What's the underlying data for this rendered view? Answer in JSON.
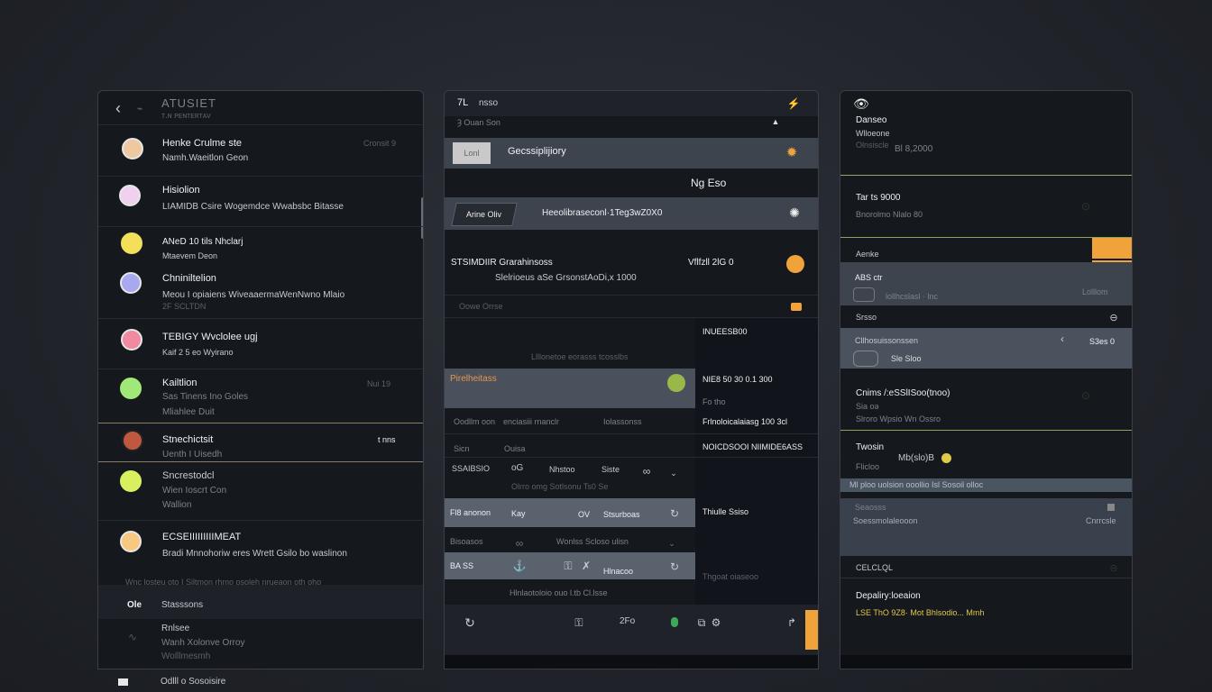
{
  "left_panel": {
    "title": "ATUSIET",
    "subtitle": "ᴛ.ɴ ᴘᴇɴᴛᴇʀᴛᴀᴠ",
    "items": [
      {
        "name": "Henke Crulme  ste",
        "meta": "Namh.Waeitlon Geon",
        "time": "Cronsit 9",
        "color": "#f0c8a0"
      },
      {
        "name": "Hisiolion",
        "meta": "LIAMIDB Csire Wogemdce Wwabsbc Bitasse",
        "time": "",
        "color": "#f0d0f0"
      },
      {
        "name": "ANeD 10  tils  Nhclarj",
        "meta": "Mtaevem Deon",
        "time": "",
        "color": "#f2e05a"
      },
      {
        "name": "Chniniltelion",
        "meta": "Meou I opiaiens WiveaaermaWenNwno Mlaio",
        "meta2": "2F SCLTDN",
        "time": "",
        "color": "#a8a8f0"
      },
      {
        "name": "TEBIGY   Wvclolee ugj",
        "meta": "Kaif 2 5 eo Wyirano",
        "time": "",
        "color": "#f08aa0"
      },
      {
        "name": "Kailtlion",
        "meta": "Sas Tinens Ino Goles",
        "meta2": "Mliahlee Duit",
        "time": "Nui 19",
        "color": "#a0e878"
      },
      {
        "name": "Stnechictsit",
        "meta": "Uenth I Uisedh",
        "time": "t  nns",
        "color": "#c05840"
      },
      {
        "name": "Sncrestodcl",
        "meta": "Wien Ioscrt Con",
        "meta2": "Wallion",
        "time": "",
        "color": "#d8f060"
      },
      {
        "name": "ECSEIIIIIIIIIMEAT",
        "meta": "Bradi  Mnnohoriw eres Wrett  Gsilo bo waslinon",
        "time": "",
        "color": "#f8c880"
      }
    ],
    "footer_caption": "Wnc losteu oto I Siltmon rhmo osoleh nrueaon oth oho",
    "footer_item1": "Stasssons",
    "footer_item1_icon": "Ole",
    "footer_item2_title": "Rnlsee",
    "footer_item2_meta": "Wanh Xolonve Orroy",
    "footer_item2_meta2": "Wolllmesmh",
    "bottom_label": "Odlll o Sosoisire"
  },
  "middle_panel": {
    "header_title": "nsso",
    "header_back": "7L",
    "sub_label": "Ȝ Ouan Son",
    "bar1_badge": "Lonl",
    "bar1_title": "Gecssiplijiory",
    "amount": "Ng  Eso",
    "pill_label": "Arine Oliv",
    "pill_text": "Heeolibraseconl·1Teg3wZ0X0",
    "stat_left": "STSIMDIIR  Grarahinsoss",
    "stat_left2": "Slelrioeus aSe GrsonstAoDi,x 1000",
    "stat_right": "Vflfzll 2lG 0",
    "section_head_left": "Oowe   Orrse",
    "section_head_right": "INUEESB00",
    "row_a": "Llllonetoe eorasss tcosslbs",
    "row_highlight_label": "Pirelheitass",
    "row_highlight_right": "NIE8 50 30   0.1 300",
    "row_highlight_right2": "Fo tho",
    "row_c_cells": [
      "Oodllm oon",
      "enciasiii rnanclr",
      "Iolassonss"
    ],
    "row_c_right": "Frlnoloicalaiasg 100 3cl",
    "row_d_cells": [
      "Sicn",
      "Ouisa"
    ],
    "row_d_right": "NOICDSOOI NIIMIDE6ASS",
    "row_e_cells": [
      "SSAIBSIO",
      "ᴏG",
      "Nhstoo",
      "Siste"
    ],
    "row_e2": "Olrro omg Sotlsonu Ts0 Se",
    "row_f_cells": [
      "Fl8 anonon",
      "Kay",
      "OV",
      "Stsurboas"
    ],
    "row_f_right": "Thiulle Ssiso",
    "row_g_cells": [
      "Bisoasos",
      "Wonlss Scloso ulisn"
    ],
    "row_h_cells": [
      "BA  SS",
      "Hlnacoo"
    ],
    "row_h_right": "Thgoat oiaseoo",
    "row_i": "Hlnlaotoloio  ouo l.tb Cl.lsse",
    "zoom": "2Fo"
  },
  "right_panel": {
    "header_icon": "eye-icon",
    "title": "Danseo",
    "meta": "Wlloeone",
    "meta2": "Olnsiscle",
    "amount": "Bl 8,2000",
    "row2_title": "Tar ts 9000",
    "row2_meta": "Bnorolmo Nlalo 80",
    "section": "Aenke",
    "bar1_title": "ABS ctr",
    "bar1_meta": "lollhcslasl · lnc",
    "bar1_right": "Lolllom",
    "row3_title": "Srsso",
    "bar2_title": "Cllhosuissonssen",
    "bar2_meta": "Sle Sloo",
    "bar2_right": "S3es 0",
    "row4_title": "Cnims   /:eSSlISoo(tnoo)",
    "row4_meta": "Sia ᴏǝ",
    "row4_meta2": "Slroro Wpsio Wn Ossro",
    "row5_title": "Twosin",
    "row5_amount": "Mb(slo)B",
    "row5_meta": "Flicloo",
    "band_text": "Ml ploo uolsion ooollio Isl Sosoil olloc",
    "row6_title": "Seaosss",
    "row6_meta": "Soessmolaleooon",
    "row6_right": "Cnrrcsle",
    "row7_title": "CELCLQL",
    "row8_title": "Depaliry:loeaion",
    "row8_meta": "LSE ThO 9Z8·  Mot  Bhlsodio... Mmh"
  },
  "colors": {
    "accent": "#f0a33a",
    "panel": "#15181d",
    "highlight": "#3d444e",
    "badge_green": "#9ab84a"
  }
}
